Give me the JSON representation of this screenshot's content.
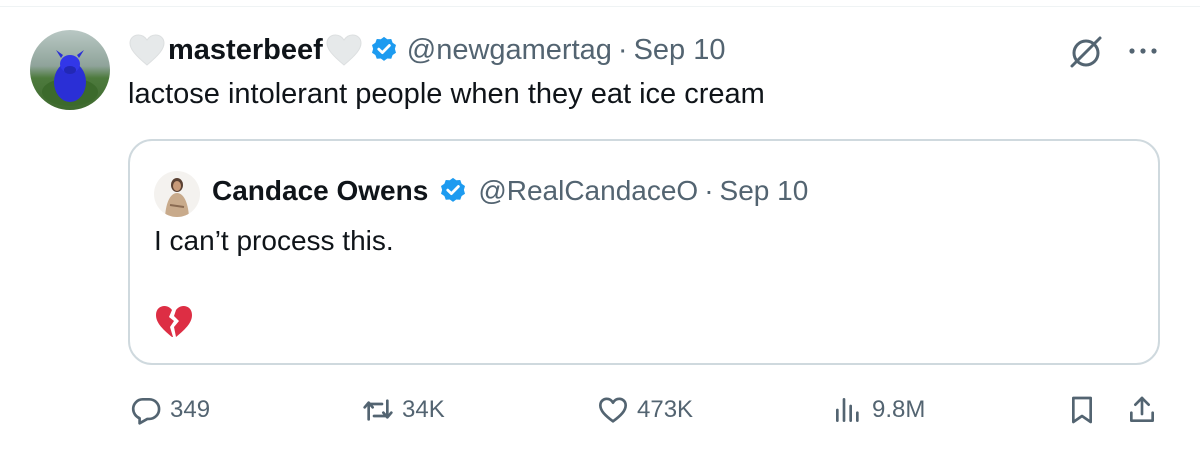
{
  "tweet": {
    "display_name": "masterbeef",
    "handle": "@newgamertag",
    "separator": "·",
    "date": "Sep 10",
    "text": "lactose intolerant people when they eat ice cream"
  },
  "quote": {
    "display_name": "Candace Owens",
    "handle": "@RealCandaceO",
    "separator": "·",
    "date": "Sep 10",
    "text": "I can’t process this.",
    "emoji": "broken-heart"
  },
  "actions": {
    "replies": "349",
    "reposts": "34K",
    "likes": "473K",
    "views": "9.8M"
  },
  "icons": {
    "verified": "verified-badge-icon",
    "grok": "grok-icon",
    "more": "more-icon",
    "reply": "reply-icon",
    "repost": "repost-icon",
    "like": "heart-icon",
    "views": "views-icon",
    "bookmark": "bookmark-icon",
    "share": "share-icon"
  },
  "colors": {
    "text": "#0f1419",
    "secondary": "#536471",
    "verified": "#1d9bf0",
    "border": "#cfd9de",
    "broken_heart": "#dd2e44"
  }
}
